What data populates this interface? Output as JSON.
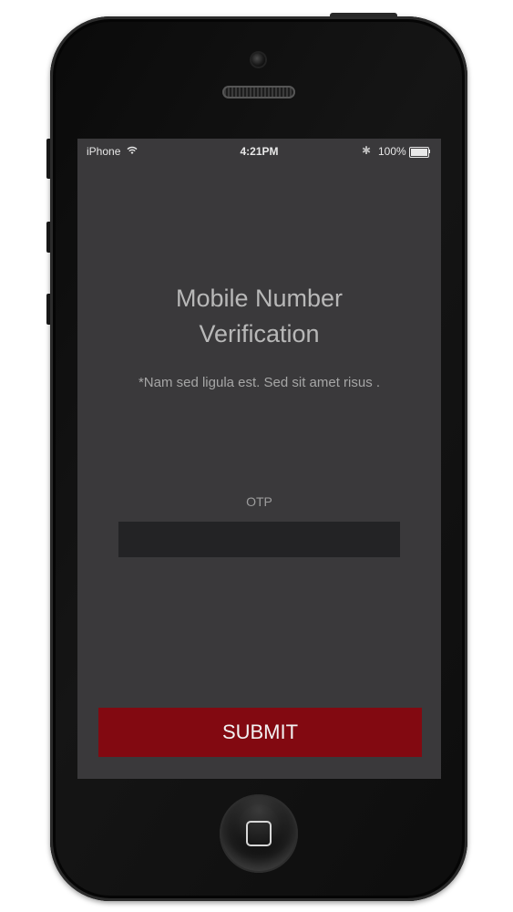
{
  "status_bar": {
    "carrier": "iPhone",
    "time": "4:21PM",
    "battery": "100%"
  },
  "screen": {
    "title_line1": "Mobile Number",
    "title_line2": "Verification",
    "subtitle": "*Nam sed ligula est. Sed sit amet risus .",
    "otp_label": "OTP",
    "otp_value": "",
    "submit_label": "SUBMIT"
  },
  "colors": {
    "screen_background": "#3a393b",
    "input_background": "#232325",
    "submit_background": "#820911"
  },
  "icons": [
    "wifi-icon",
    "bluetooth-icon",
    "battery-icon",
    "home-button-icon"
  ]
}
